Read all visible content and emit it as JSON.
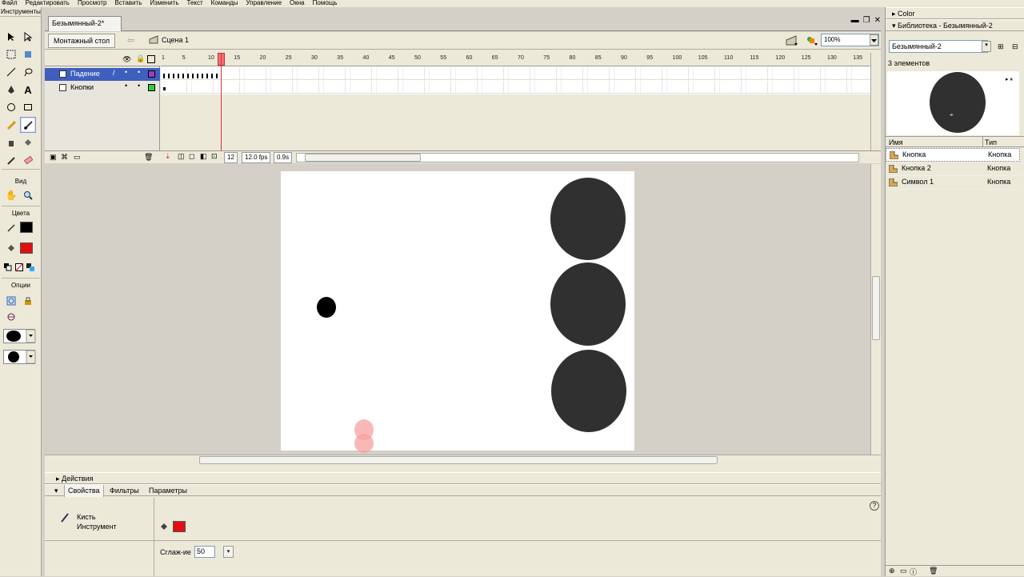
{
  "menu": [
    "Файл",
    "Редактировать",
    "Просмотр",
    "Вставить",
    "Изменить",
    "Текст",
    "Команды",
    "Управление",
    "Окна",
    "Помощь"
  ],
  "toolbox": {
    "title": "Инструменты",
    "view_label": "Вид",
    "colors_label": "Цвета",
    "options_label": "Опции",
    "stroke_color": "#000000",
    "fill_color": "#e01010"
  },
  "document": {
    "tab_title": "Безымянный-2*",
    "stage_button": "Монтажный стол",
    "scene_label": "Сцена 1",
    "zoom": "100%"
  },
  "timeline": {
    "ruler": [
      "1",
      "5",
      "10",
      "15",
      "20",
      "25",
      "30",
      "35",
      "40",
      "45",
      "50",
      "55",
      "60",
      "65",
      "70",
      "75",
      "80",
      "85",
      "90",
      "95",
      "100",
      "105",
      "110",
      "115",
      "120",
      "125",
      "130",
      "135"
    ],
    "layers": [
      {
        "name": "Падение",
        "active": true,
        "color": "#9a3fc0"
      },
      {
        "name": "Кнопки",
        "active": false,
        "color": "#37c837"
      }
    ],
    "current_frame": "12",
    "fps": "12.0 fps",
    "time": "0.9s"
  },
  "stage": {
    "circle_color": "#303030",
    "ball_color": "#000000",
    "onion_color": "#f7a0a0"
  },
  "actions_panel": {
    "title": "Действия"
  },
  "properties_panel": {
    "tabs": [
      "Свойства",
      "Фильтры",
      "Параметры"
    ],
    "tool_name": "Кисть",
    "tool_type": "Инструмент",
    "fill_color": "#e01010",
    "smoothing_label": "Сглаж-ие",
    "smoothing_value": "50"
  },
  "color_panel": {
    "title": "Color"
  },
  "library": {
    "title": "Библиотека - Безымянный-2",
    "selected_doc": "Безымянный-2",
    "count": "3 элементов",
    "col_name": "Имя",
    "col_type": "Тип",
    "items": [
      {
        "name": "Кнопка",
        "type": "Кнопка"
      },
      {
        "name": "Кнопка 2",
        "type": "Кнопка"
      },
      {
        "name": "Символ 1",
        "type": "Кнопка"
      }
    ],
    "preview_color": "#303030"
  }
}
